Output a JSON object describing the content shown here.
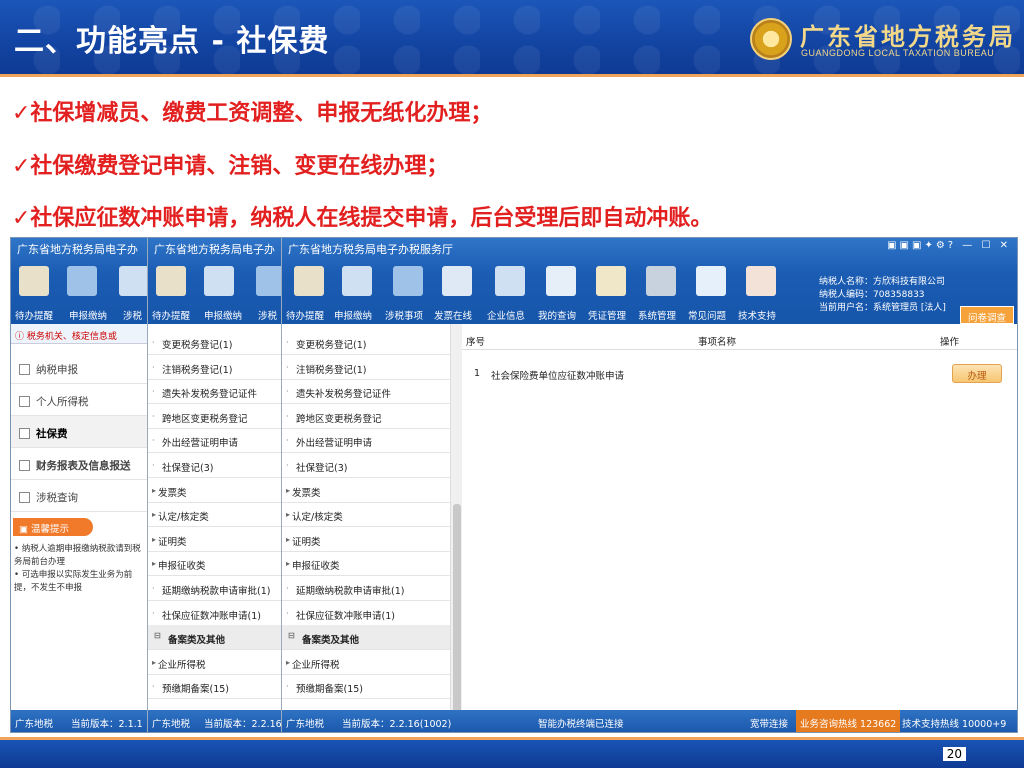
{
  "slide": {
    "title": "二、功能亮点 - 社保费",
    "logo_cn": "广东省地方税务局",
    "logo_en": "GUANGDONG LOCAL TAXATION BUREAU",
    "page": "20"
  },
  "bullets": [
    "✓社保增减员、缴费工资调整、申报无纸化办理；",
    "✓社保缴费登记申请、注销、变更在线办理；",
    "✓社保应征数冲账申请，纳税人在线提交申请，后台受理后即自动冲账。"
  ],
  "win1": {
    "title": "广东省地方税务局电子办",
    "tools": [
      "待办提醒",
      "申报缴纳",
      "涉税"
    ],
    "notice": "税务机关、核定信息或",
    "nav": [
      "纳税申报",
      "个人所得税",
      "社保费",
      "财务报表及信息报送",
      "涉税查询"
    ],
    "tips_title": "温馨提示",
    "tips": [
      "纳税人逾期申报缴纳税款请到税务局前台办理",
      "可选申报以实际发生业务为前提，不发生不申报"
    ],
    "status": [
      "广东地税",
      "当前版本：2.1.1"
    ]
  },
  "win2": {
    "title": "广东省地方税务局电子办",
    "tools": [
      "待办提醒",
      "申报缴纳",
      "涉税"
    ],
    "status": [
      "广东地税",
      "当前版本：2.2.16"
    ]
  },
  "menu": [
    "变更税务登记(1)",
    "注销税务登记(1)",
    "遗失补发税务登记证件",
    "跨地区变更税务登记",
    "外出经营证明申请",
    "社保登记(3)",
    "发票类",
    "认定/核定类",
    "证明类",
    "申报征收类",
    "延期缴纳税款申请审批(1)",
    "社保应征数冲账申请(1)",
    "备案类及其他",
    "企业所得税",
    "预缴期备案(15)"
  ],
  "win3": {
    "title": "广东省地方税务局电子办税服务厅",
    "tools": [
      "待办提醒",
      "申报缴纳",
      "涉税事项",
      "发票在线",
      "企业信息",
      "我的查询",
      "凭证管理",
      "系统管理",
      "常见问题",
      "技术支持"
    ],
    "info": [
      "纳税人名称：方欣科技有限公司",
      "纳税人编码：708358833",
      "当前用户名：系统管理员 [法人]"
    ],
    "survey": "问卷调查",
    "table": {
      "headers": [
        "序号",
        "事项名称",
        "操作"
      ],
      "rows": [
        {
          "no": "1",
          "name": "社会保险费单位应征数冲账申请",
          "action": "办理"
        }
      ]
    },
    "status": [
      "广东地税",
      "当前版本：2.2.16(1002)",
      "智能办税终端已连接",
      "宽带连接",
      "业务咨询热线 123662",
      "技术支持热线 10000+9"
    ]
  }
}
